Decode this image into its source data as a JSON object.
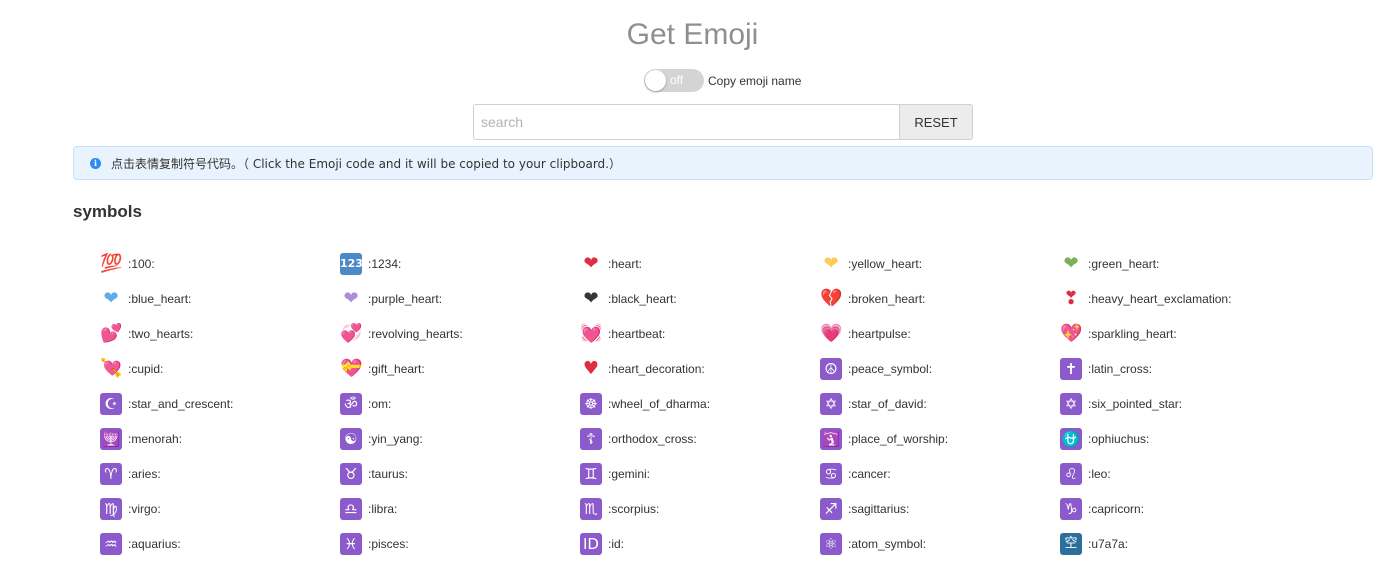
{
  "title": "Get Emoji",
  "toggle": {
    "state_text": "off",
    "label": "Copy emoji name"
  },
  "search": {
    "placeholder": "search",
    "value": "",
    "reset_label": "RESET"
  },
  "notice": {
    "text": "点击表情复制符号代码。（ Click the Emoji code and it will be copied to your clipboard.）"
  },
  "section": {
    "title": "symbols"
  },
  "emojis": [
    {
      "glyph": "💯",
      "color": "#e0323b",
      "style": "plain",
      "code": ":100:"
    },
    {
      "glyph": "1234",
      "color": "#4c8ac7",
      "style": "blue",
      "code": ":1234:"
    },
    {
      "glyph": "❤",
      "color": "#dd2e44",
      "style": "plain",
      "code": ":heart:"
    },
    {
      "glyph": "❤",
      "color": "#fdcb58",
      "style": "plain",
      "code": ":yellow_heart:"
    },
    {
      "glyph": "❤",
      "color": "#78b159",
      "style": "plain",
      "code": ":green_heart:"
    },
    {
      "glyph": "❤",
      "color": "#5dadec",
      "style": "plain",
      "code": ":blue_heart:"
    },
    {
      "glyph": "❤",
      "color": "#aa8ed6",
      "style": "plain",
      "code": ":purple_heart:"
    },
    {
      "glyph": "❤",
      "color": "#31373d",
      "style": "plain",
      "code": ":black_heart:"
    },
    {
      "glyph": "💔",
      "color": "#dd2e44",
      "style": "plain",
      "code": ":broken_heart:"
    },
    {
      "glyph": "❣",
      "color": "#dd2e44",
      "style": "plain",
      "code": ":heavy_heart_exclamation:"
    },
    {
      "glyph": "💕",
      "color": "#dd2e44",
      "style": "plain",
      "code": ":two_hearts:"
    },
    {
      "glyph": "💞",
      "color": "#dd2e44",
      "style": "plain",
      "code": ":revolving_hearts:"
    },
    {
      "glyph": "💓",
      "color": "#dd2e44",
      "style": "plain",
      "code": ":heartbeat:"
    },
    {
      "glyph": "💗",
      "color": "#f4abba",
      "style": "plain",
      "code": ":heartpulse:"
    },
    {
      "glyph": "💖",
      "color": "#dd2e44",
      "style": "plain",
      "code": ":sparkling_heart:"
    },
    {
      "glyph": "💘",
      "color": "#dd2e44",
      "style": "plain",
      "code": ":cupid:"
    },
    {
      "glyph": "💝",
      "color": "#dd2e44",
      "style": "plain",
      "code": ":gift_heart:"
    },
    {
      "glyph": "♥",
      "color": "#dd2e44",
      "style": "plain",
      "code": ":heart_decoration:"
    },
    {
      "glyph": "☮",
      "color": "#8c5bcb",
      "style": "purple",
      "code": ":peace_symbol:"
    },
    {
      "glyph": "✝",
      "color": "#8c5bcb",
      "style": "purple",
      "code": ":latin_cross:"
    },
    {
      "glyph": "☪",
      "color": "#8c5bcb",
      "style": "purple",
      "code": ":star_and_crescent:"
    },
    {
      "glyph": "ॐ",
      "color": "#8c5bcb",
      "style": "purple",
      "code": ":om:"
    },
    {
      "glyph": "☸",
      "color": "#8c5bcb",
      "style": "purple",
      "code": ":wheel_of_dharma:"
    },
    {
      "glyph": "✡",
      "color": "#8c5bcb",
      "style": "purple",
      "code": ":star_of_david:"
    },
    {
      "glyph": "✡",
      "color": "#8c5bcb",
      "style": "purple",
      "code": ":six_pointed_star:"
    },
    {
      "glyph": "🕎",
      "color": "#8c5bcb",
      "style": "purple",
      "code": ":menorah:"
    },
    {
      "glyph": "☯",
      "color": "#8c5bcb",
      "style": "purple",
      "code": ":yin_yang:"
    },
    {
      "glyph": "☦",
      "color": "#8c5bcb",
      "style": "purple",
      "code": ":orthodox_cross:"
    },
    {
      "glyph": "🛐",
      "color": "#8c5bcb",
      "style": "purple",
      "code": ":place_of_worship:"
    },
    {
      "glyph": "⛎",
      "color": "#8c5bcb",
      "style": "purple",
      "code": ":ophiuchus:"
    },
    {
      "glyph": "♈",
      "color": "#8c5bcb",
      "style": "purple",
      "code": ":aries:"
    },
    {
      "glyph": "♉",
      "color": "#8c5bcb",
      "style": "purple",
      "code": ":taurus:"
    },
    {
      "glyph": "♊",
      "color": "#8c5bcb",
      "style": "purple",
      "code": ":gemini:"
    },
    {
      "glyph": "♋",
      "color": "#8c5bcb",
      "style": "purple",
      "code": ":cancer:"
    },
    {
      "glyph": "♌",
      "color": "#8c5bcb",
      "style": "purple",
      "code": ":leo:"
    },
    {
      "glyph": "♍",
      "color": "#8c5bcb",
      "style": "purple",
      "code": ":virgo:"
    },
    {
      "glyph": "♎",
      "color": "#8c5bcb",
      "style": "purple",
      "code": ":libra:"
    },
    {
      "glyph": "♏",
      "color": "#8c5bcb",
      "style": "purple",
      "code": ":scorpius:"
    },
    {
      "glyph": "♐",
      "color": "#8c5bcb",
      "style": "purple",
      "code": ":sagittarius:"
    },
    {
      "glyph": "♑",
      "color": "#8c5bcb",
      "style": "purple",
      "code": ":capricorn:"
    },
    {
      "glyph": "♒",
      "color": "#8c5bcb",
      "style": "purple",
      "code": ":aquarius:"
    },
    {
      "glyph": "♓",
      "color": "#8c5bcb",
      "style": "purple",
      "code": ":pisces:"
    },
    {
      "glyph": "ID",
      "color": "#8c5bcb",
      "style": "purple",
      "code": ":id:"
    },
    {
      "glyph": "⚛",
      "color": "#8c5bcb",
      "style": "purple",
      "code": ":atom_symbol:"
    },
    {
      "glyph": "空",
      "color": "#2c6f9c",
      "style": "teal",
      "code": ":u7a7a:"
    }
  ]
}
